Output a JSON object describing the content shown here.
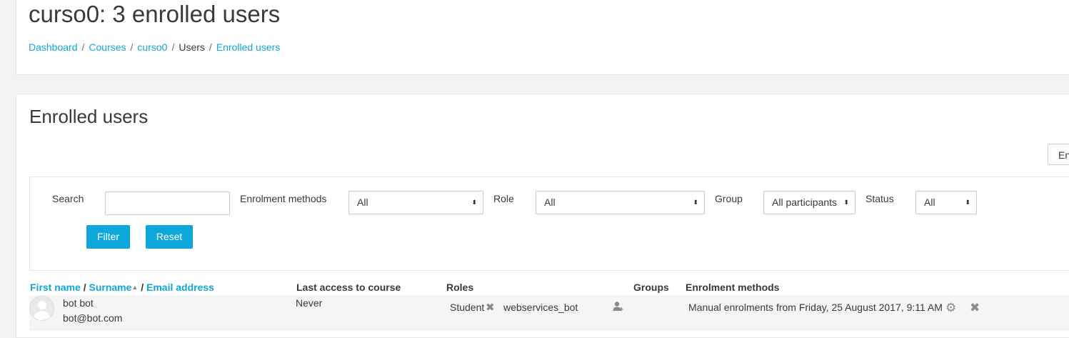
{
  "header": {
    "title": "curso0: 3 enrolled users",
    "breadcrumb": [
      {
        "label": "Dashboard"
      },
      {
        "label": "Courses"
      },
      {
        "label": "curso0"
      },
      {
        "label": "Users"
      },
      {
        "label": "Enrolled users"
      }
    ]
  },
  "main": {
    "title": "Enrolled users",
    "top_right_button": "En"
  },
  "filters": {
    "search_label": "Search",
    "search_value": "",
    "methods_label": "Enrolment methods",
    "methods_value": "All",
    "role_label": "Role",
    "role_value": "All",
    "group_label": "Group",
    "group_value": "All participants",
    "status_label": "Status",
    "status_value": "All",
    "filter_button": "Filter",
    "reset_button": "Reset"
  },
  "table": {
    "headers": {
      "first_name": "First name",
      "surname": "Surname",
      "email": "Email address",
      "sep": "/",
      "last_access": "Last access to course",
      "roles": "Roles",
      "groups": "Groups",
      "methods": "Enrolment methods"
    },
    "rows": [
      {
        "name": "bot bot",
        "email": "bot@bot.com",
        "last_access": "Never",
        "role1": "Student",
        "role2": "webservices_bot",
        "groups": "",
        "method": "Manual enrolments from Friday, 25 August 2017, 9:11 AM"
      }
    ]
  },
  "icons": {
    "sort": "sort-ascending-icon",
    "remove_role": "close-icon",
    "assign_role": "user-plus-icon",
    "edit_enrolment": "gear-icon",
    "unenrol": "close-icon"
  },
  "colors": {
    "accent": "#0ea7dc",
    "text": "#373a3c",
    "background": "#f2f2f2"
  }
}
